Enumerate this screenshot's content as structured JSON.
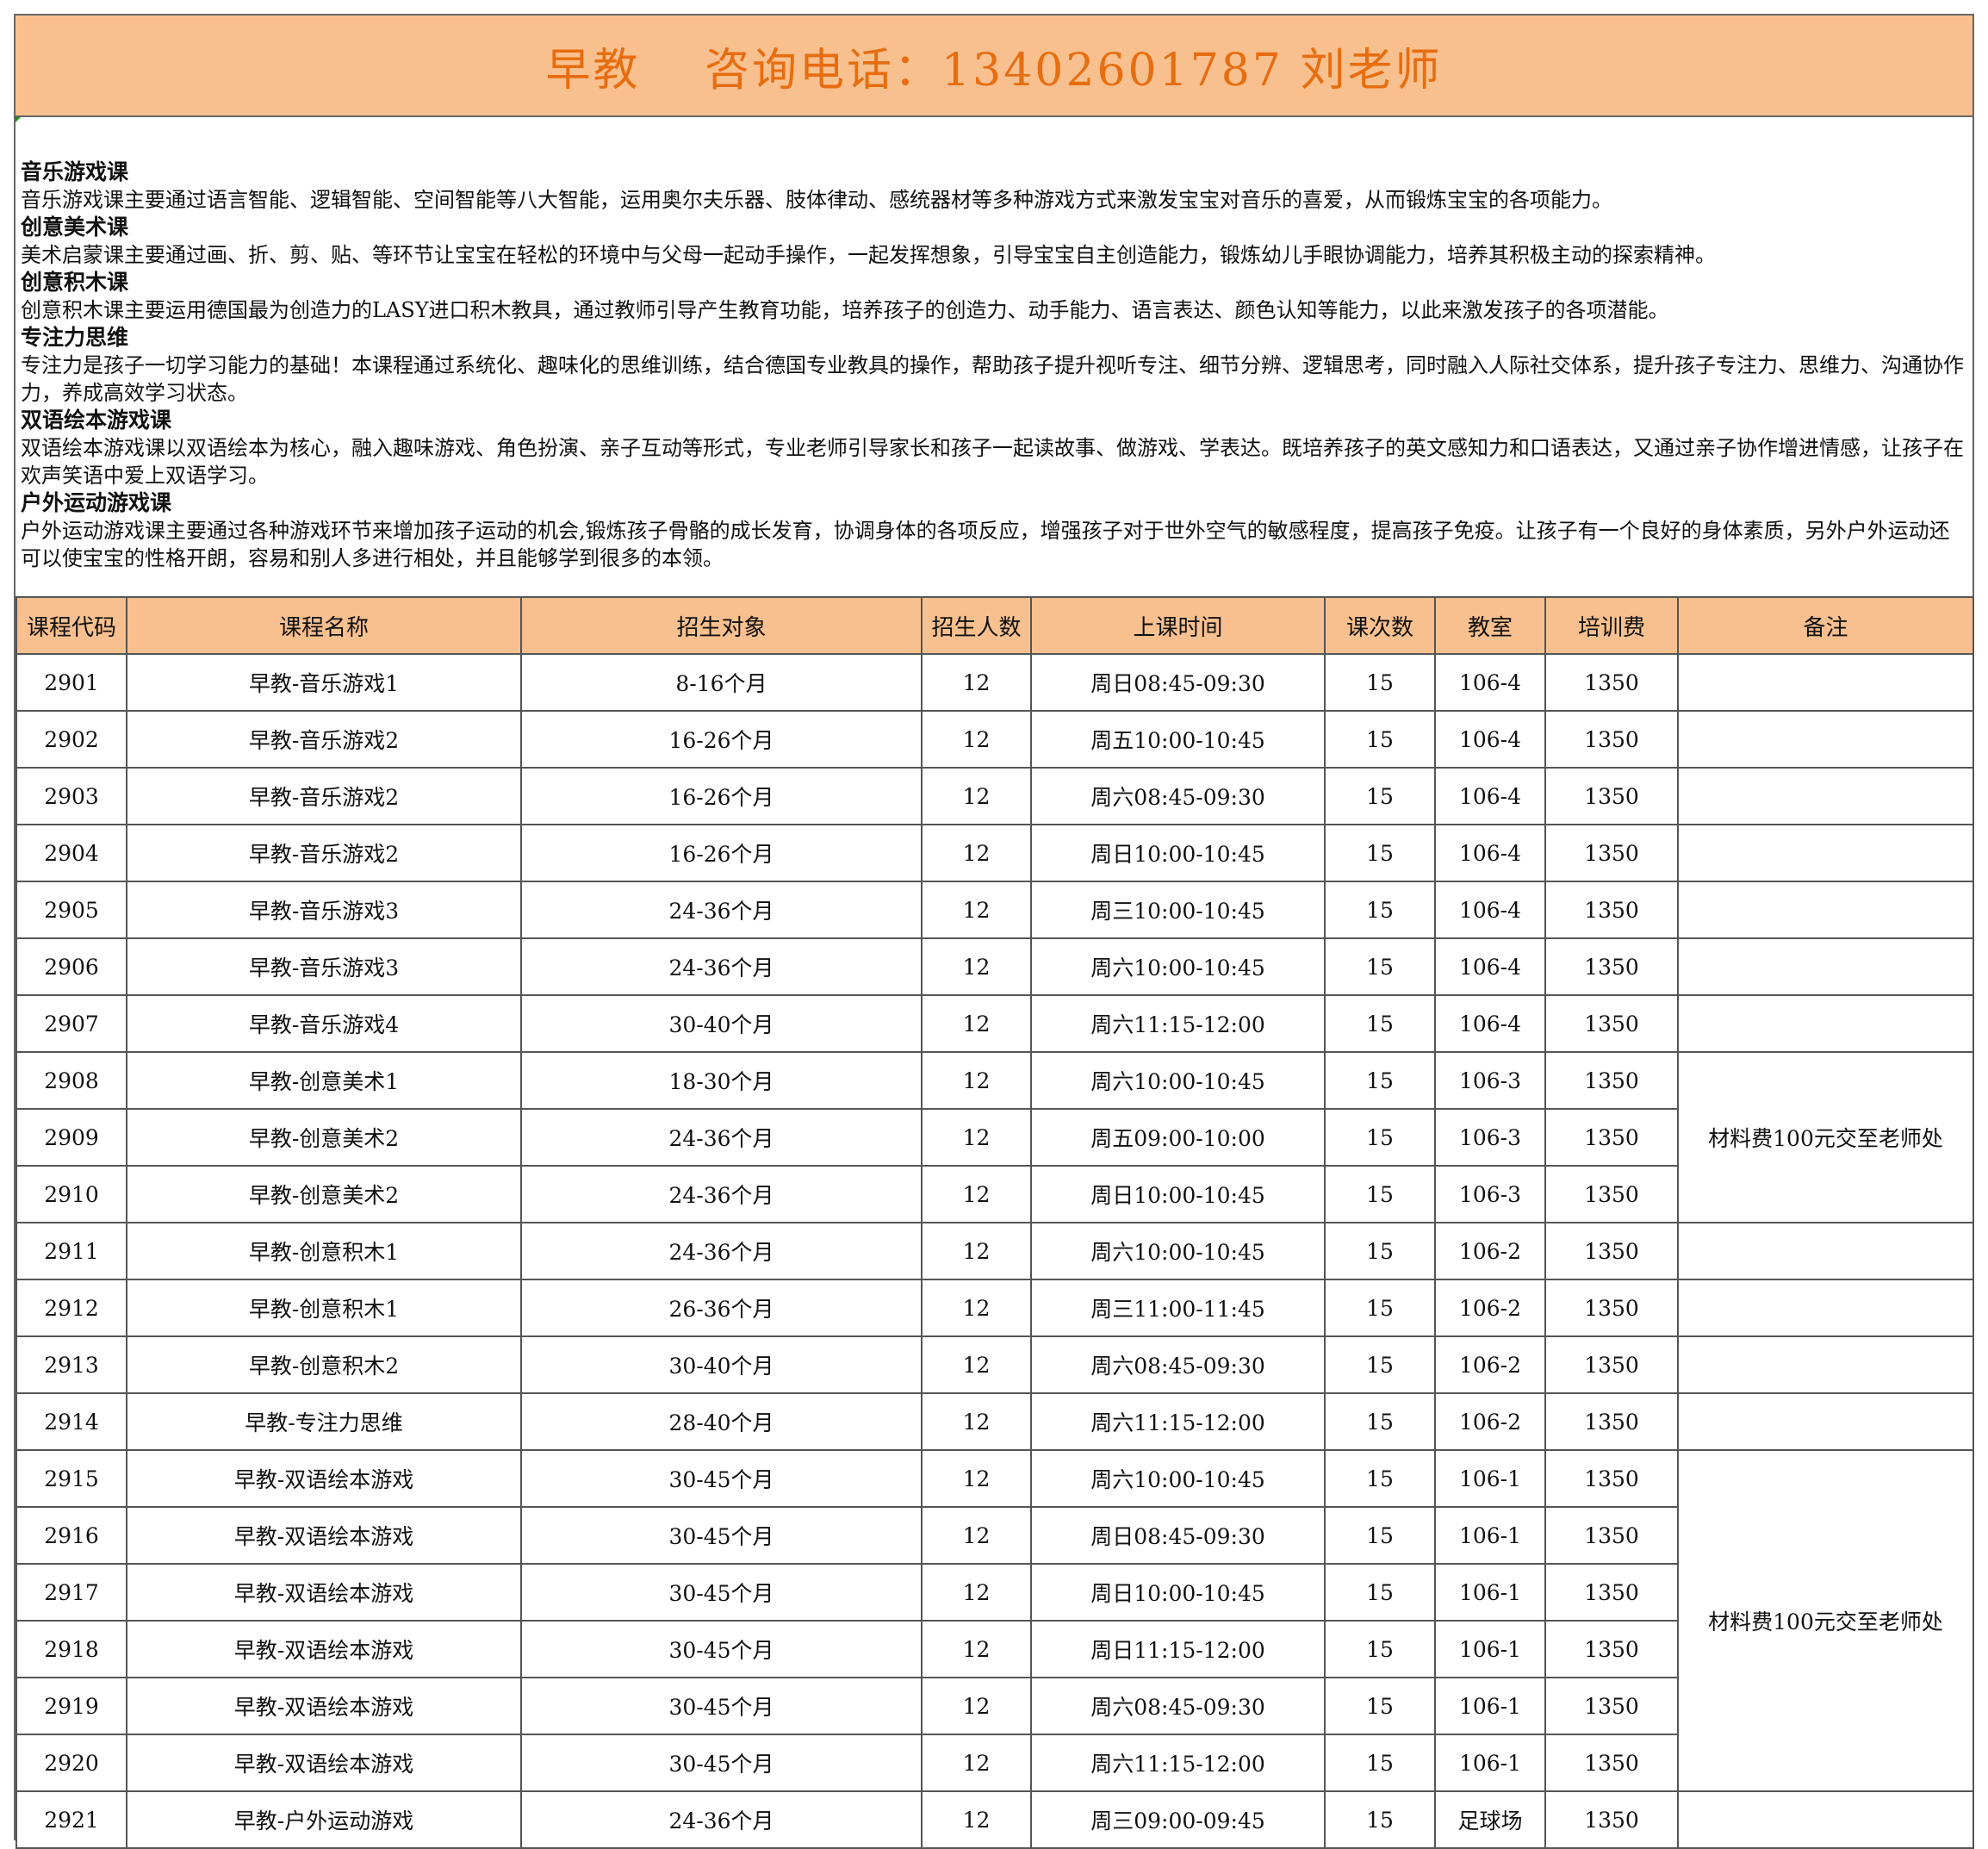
{
  "title": "早教　 咨询电话：13402601787 刘老师",
  "intro": [
    {
      "heading": "音乐游戏课",
      "text": "音乐游戏课主要通过语言智能、逻辑智能、空间智能等八大智能，运用奥尔夫乐器、肢体律动、感统器材等多种游戏方式来激发宝宝对音乐的喜爱，从而锻炼宝宝的各项能力。"
    },
    {
      "heading": "创意美术课",
      "text": "美术启蒙课主要通过画、折、剪、贴、等环节让宝宝在轻松的环境中与父母一起动手操作，一起发挥想象，引导宝宝自主创造能力，锻炼幼儿手眼协调能力，培养其积极主动的探索精神。"
    },
    {
      "heading": "创意积木课",
      "text": "创意积木课主要运用德国最为创造力的LASY进口积木教具，通过教师引导产生教育功能，培养孩子的创造力、动手能力、语言表达、颜色认知等能力，以此来激发孩子的各项潜能。"
    },
    {
      "heading": "专注力思维",
      "text": "专注力是孩子一切学习能力的基础！本课程通过系统化、趣味化的思维训练，结合德国专业教具的操作，帮助孩子提升视听专注、细节分辨、逻辑思考，同时融入人际社交体系，提升孩子专注力、思维力、沟通协作力，养成高效学习状态。"
    },
    {
      "heading": "双语绘本游戏课",
      "text": "双语绘本游戏课以双语绘本为核心，融入趣味游戏、角色扮演、亲子互动等形式，专业老师引导家长和孩子一起读故事、做游戏、学表达。既培养孩子的英文感知力和口语表达，又通过亲子协作增进情感，让孩子在欢声笑语中爱上双语学习。"
    },
    {
      "heading": "户外运动游戏课",
      "text": "户外运动游戏课主要通过各种游戏环节来增加孩子运动的机会,锻炼孩子骨骼的成长发育，协调身体的各项反应，增强孩子对于世外空气的敏感程度，提高孩子免疫。让孩子有一个良好的身体素质，另外户外运动还可以使宝宝的性格开朗，容易和别人多进行相处，并且能够学到很多的本领。"
    }
  ],
  "table": {
    "headers": [
      "课程代码",
      "课程名称",
      "招生对象",
      "招生人数",
      "上课时间",
      "课次数",
      "教室",
      "培训费",
      "备注"
    ],
    "rows": [
      [
        "2901",
        "早教-音乐游戏1",
        "8-16个月",
        "12",
        "周日08:45-09:30",
        "15",
        "106-4",
        "1350"
      ],
      [
        "2902",
        "早教-音乐游戏2",
        "16-26个月",
        "12",
        "周五10:00-10:45",
        "15",
        "106-4",
        "1350"
      ],
      [
        "2903",
        "早教-音乐游戏2",
        "16-26个月",
        "12",
        "周六08:45-09:30",
        "15",
        "106-4",
        "1350"
      ],
      [
        "2904",
        "早教-音乐游戏2",
        "16-26个月",
        "12",
        "周日10:00-10:45",
        "15",
        "106-4",
        "1350"
      ],
      [
        "2905",
        "早教-音乐游戏3",
        "24-36个月",
        "12",
        "周三10:00-10:45",
        "15",
        "106-4",
        "1350"
      ],
      [
        "2906",
        "早教-音乐游戏3",
        "24-36个月",
        "12",
        "周六10:00-10:45",
        "15",
        "106-4",
        "1350"
      ],
      [
        "2907",
        "早教-音乐游戏4",
        "30-40个月",
        "12",
        "周六11:15-12:00",
        "15",
        "106-4",
        "1350"
      ],
      [
        "2908",
        "早教-创意美术1",
        "18-30个月",
        "12",
        "周六10:00-10:45",
        "15",
        "106-3",
        "1350"
      ],
      [
        "2909",
        "早教-创意美术2",
        "24-36个月",
        "12",
        "周五09:00-10:00",
        "15",
        "106-3",
        "1350"
      ],
      [
        "2910",
        "早教-创意美术2",
        "24-36个月",
        "12",
        "周日10:00-10:45",
        "15",
        "106-3",
        "1350"
      ],
      [
        "2911",
        "早教-创意积木1",
        "24-36个月",
        "12",
        "周六10:00-10:45",
        "15",
        "106-2",
        "1350"
      ],
      [
        "2912",
        "早教-创意积木1",
        "26-36个月",
        "12",
        "周三11:00-11:45",
        "15",
        "106-2",
        "1350"
      ],
      [
        "2913",
        "早教-创意积木2",
        "30-40个月",
        "12",
        "周六08:45-09:30",
        "15",
        "106-2",
        "1350"
      ],
      [
        "2914",
        "早教-专注力思维",
        "28-40个月",
        "12",
        "周六11:15-12:00",
        "15",
        "106-2",
        "1350"
      ],
      [
        "2915",
        "早教-双语绘本游戏",
        "30-45个月",
        "12",
        "周六10:00-10:45",
        "15",
        "106-1",
        "1350"
      ],
      [
        "2916",
        "早教-双语绘本游戏",
        "30-45个月",
        "12",
        "周日08:45-09:30",
        "15",
        "106-1",
        "1350"
      ],
      [
        "2917",
        "早教-双语绘本游戏",
        "30-45个月",
        "12",
        "周日10:00-10:45",
        "15",
        "106-1",
        "1350"
      ],
      [
        "2918",
        "早教-双语绘本游戏",
        "30-45个月",
        "12",
        "周日11:15-12:00",
        "15",
        "106-1",
        "1350"
      ],
      [
        "2919",
        "早教-双语绘本游戏",
        "30-45个月",
        "12",
        "周六08:45-09:30",
        "15",
        "106-1",
        "1350"
      ],
      [
        "2920",
        "早教-双语绘本游戏",
        "30-45个月",
        "12",
        "周六11:15-12:00",
        "15",
        "106-1",
        "1350"
      ],
      [
        "2921",
        "早教-户外运动游戏",
        "24-36个月",
        "12",
        "周三09:00-09:45",
        "15",
        "足球场",
        "1350"
      ]
    ],
    "notes": {
      "art": "材料费100元交至老师处",
      "bilingual": "材料费100元交至老师处"
    }
  },
  "colors": {
    "header_fill": "#f8c08e",
    "title_text": "#e66d10",
    "border": "#555555"
  }
}
